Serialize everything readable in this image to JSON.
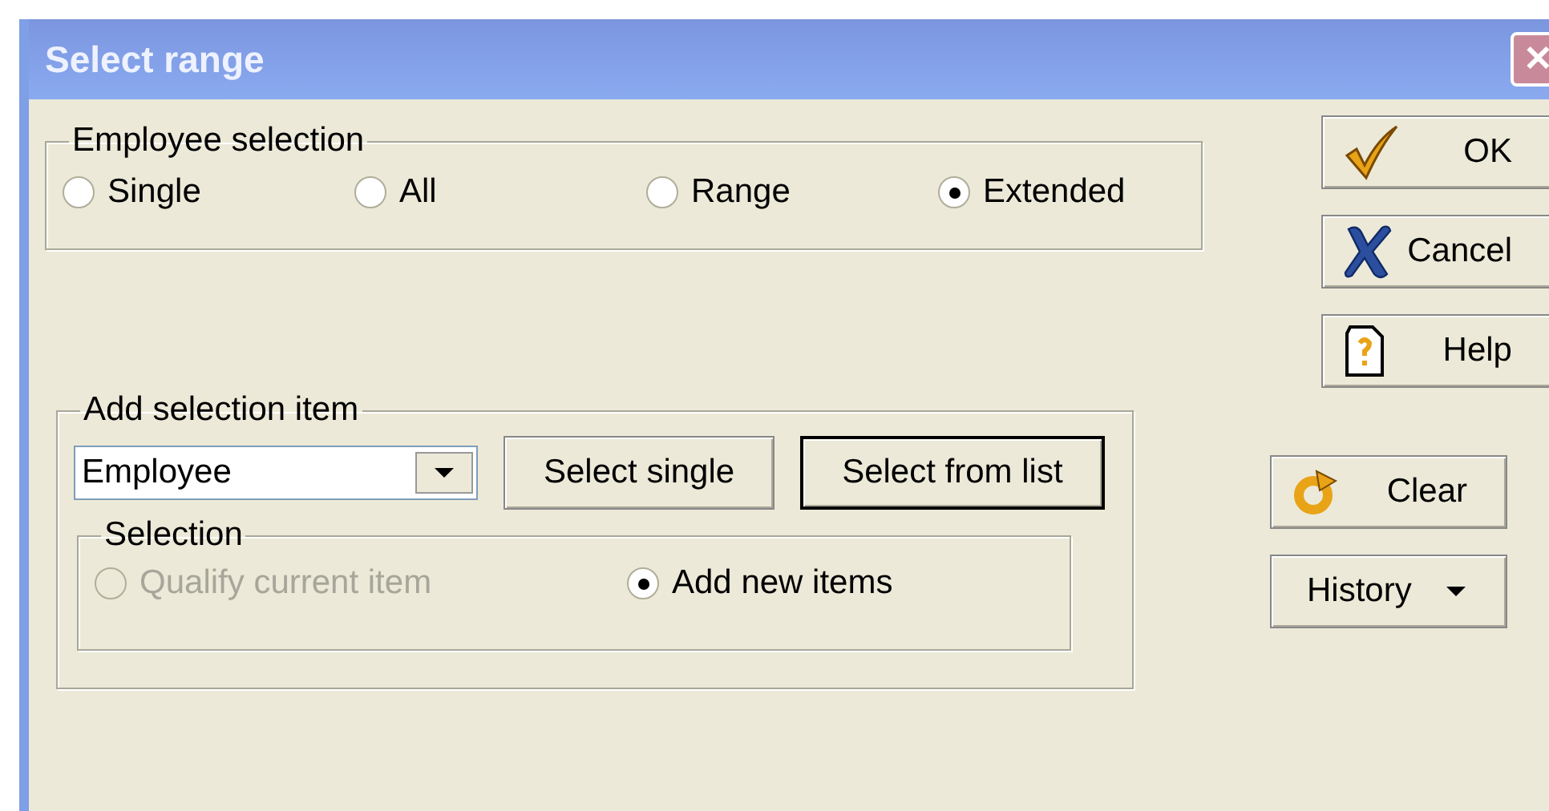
{
  "window": {
    "title": "Select range",
    "close_glyph": "✕"
  },
  "employee_selection": {
    "label": "Employee selection",
    "options": [
      {
        "label": "Single",
        "selected": false
      },
      {
        "label": "All",
        "selected": false
      },
      {
        "label": "Range",
        "selected": false
      },
      {
        "label": "Extended",
        "selected": true
      }
    ]
  },
  "add_selection_item": {
    "label": "Add selection item",
    "dropdown": {
      "value": "Employee"
    },
    "buttons": [
      {
        "label": "Select single",
        "default": false
      },
      {
        "label": "Select from list",
        "default": true
      }
    ],
    "selection": {
      "label": "Selection",
      "options": [
        {
          "label": "Qualify current item",
          "selected": false,
          "disabled": true
        },
        {
          "label": "Add new items",
          "selected": true,
          "disabled": false
        }
      ]
    }
  },
  "side_buttons": [
    {
      "kind": "ok",
      "label": "OK"
    },
    {
      "kind": "cancel",
      "label": "Cancel"
    },
    {
      "kind": "help",
      "label": "Help"
    }
  ],
  "lower_buttons": [
    {
      "kind": "clear",
      "label": "Clear"
    },
    {
      "kind": "history",
      "label": "History"
    }
  ]
}
